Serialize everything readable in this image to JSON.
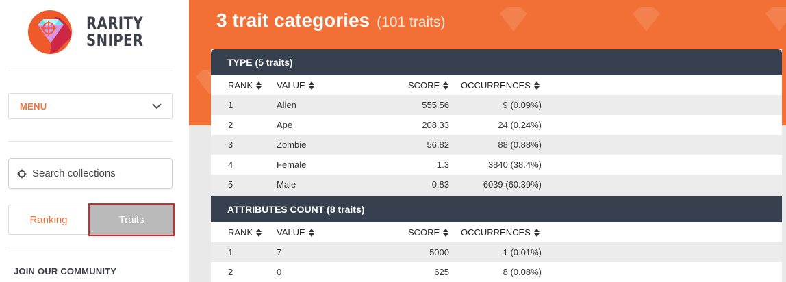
{
  "brand": {
    "line1": "RARITY",
    "line2": "SNIPER"
  },
  "sidebar": {
    "menu_label": "MENU",
    "search_label": "Search collections",
    "tabs": [
      {
        "label": "Ranking"
      },
      {
        "label": "Traits"
      }
    ],
    "community_label": "JOIN OUR COMMUNITY"
  },
  "header": {
    "title": "3 trait categories",
    "subtitle": "(101 traits)"
  },
  "columns": {
    "rank": "RANK",
    "value": "VALUE",
    "score": "SCORE",
    "occurrences": "OCCURRENCES"
  },
  "tables": [
    {
      "title": "TYPE (5 traits)",
      "rows": [
        {
          "rank": "1",
          "value": "Alien",
          "score": "555.56",
          "occurrences": "9 (0.09%)"
        },
        {
          "rank": "2",
          "value": "Ape",
          "score": "208.33",
          "occurrences": "24 (0.24%)"
        },
        {
          "rank": "3",
          "value": "Zombie",
          "score": "56.82",
          "occurrences": "88 (0.88%)"
        },
        {
          "rank": "4",
          "value": "Female",
          "score": "1.3",
          "occurrences": "3840 (38.4%)"
        },
        {
          "rank": "5",
          "value": "Male",
          "score": "0.83",
          "occurrences": "6039 (60.39%)"
        }
      ]
    },
    {
      "title": "ATTRIBUTES COUNT (8 traits)",
      "rows": [
        {
          "rank": "1",
          "value": "7",
          "score": "5000",
          "occurrences": "1 (0.01%)"
        },
        {
          "rank": "2",
          "value": "0",
          "score": "625",
          "occurrences": "8 (0.08%)"
        }
      ]
    }
  ],
  "colors": {
    "accent": "#f26f35",
    "panel_header": "#37404f",
    "active_tab": "#b9b9b9",
    "highlight": "#d9262e"
  }
}
